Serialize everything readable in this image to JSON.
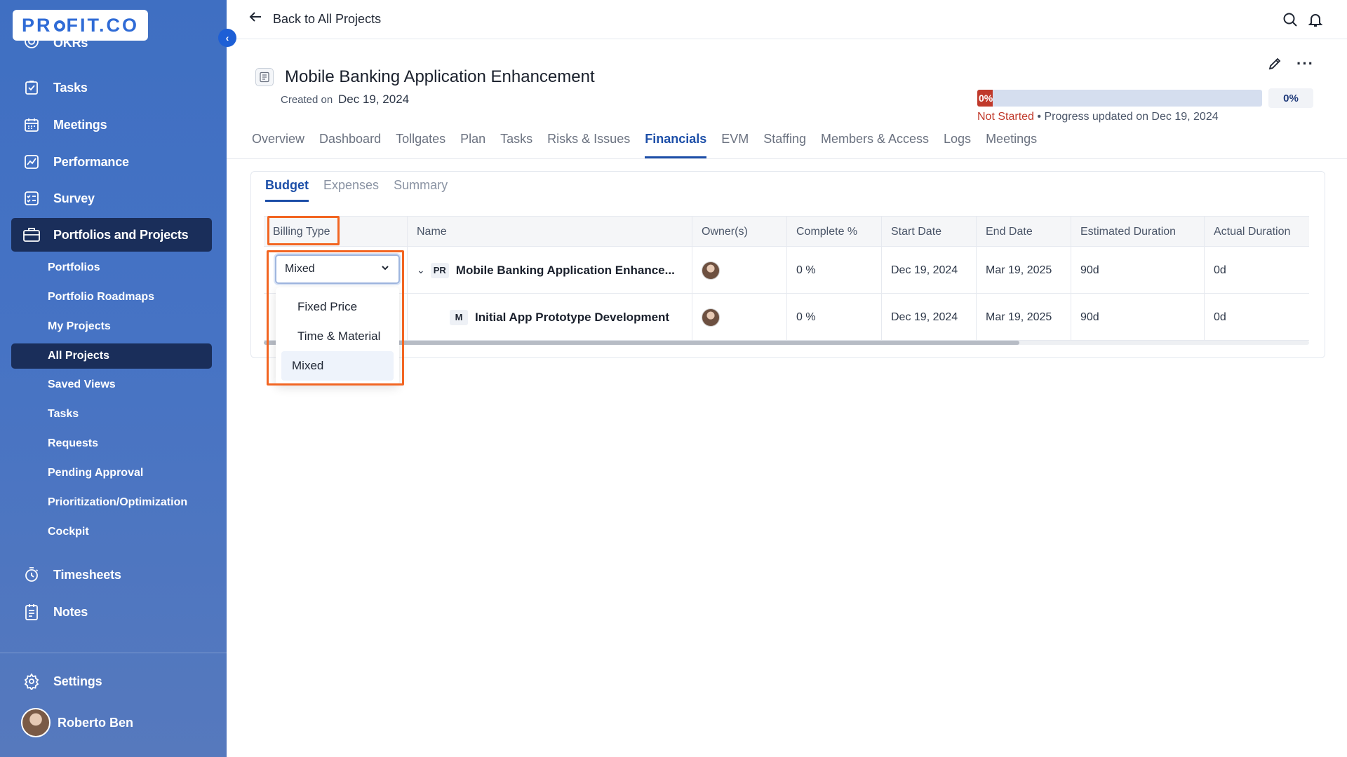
{
  "brand": {
    "logo_pre": "PR",
    "logo_post": "FIT.CO"
  },
  "sidebar": {
    "partial_item": "OKRs",
    "items": [
      {
        "label": "Tasks",
        "icon": "tasks-icon"
      },
      {
        "label": "Meetings",
        "icon": "calendar-icon"
      },
      {
        "label": "Performance",
        "icon": "performance-icon"
      },
      {
        "label": "Survey",
        "icon": "survey-icon"
      },
      {
        "label": "Portfolios and Projects",
        "icon": "briefcase-icon"
      }
    ],
    "sub_items": [
      "Portfolios",
      "Portfolio Roadmaps",
      "My Projects",
      "All Projects",
      "Saved Views",
      "Tasks",
      "Requests",
      "Pending Approval",
      "Prioritization/Optimization",
      "Cockpit"
    ],
    "after_items": [
      {
        "label": "Timesheets",
        "icon": "timer-icon"
      },
      {
        "label": "Notes",
        "icon": "notes-icon"
      }
    ],
    "settings": "Settings",
    "user_name": "Roberto Ben"
  },
  "topbar": {
    "back_label": "Back to All Projects"
  },
  "project": {
    "title": "Mobile Banking Application Enhancement",
    "created_label": "Created on",
    "created_date": "Dec 19, 2024",
    "progress_fill_label": "0%",
    "progress_pct": "0%",
    "status": "Not Started",
    "status_sep": " • ",
    "progress_updated": "Progress updated on Dec 19, 2024"
  },
  "tabs": [
    "Overview",
    "Dashboard",
    "Tollgates",
    "Plan",
    "Tasks",
    "Risks & Issues",
    "Financials",
    "EVM",
    "Staffing",
    "Members & Access",
    "Logs",
    "Meetings"
  ],
  "subtabs": [
    "Budget",
    "Expenses",
    "Summary"
  ],
  "table": {
    "headers": [
      "Billing Type",
      "Name",
      "Owner(s)",
      "Complete %",
      "Start Date",
      "End Date",
      "Estimated Duration",
      "Actual Duration"
    ],
    "rows": [
      {
        "type_badge": "PR",
        "name": "Mobile Banking Application Enhance...",
        "complete": "0 %",
        "start": "Dec 19, 2024",
        "end": "Mar 19, 2025",
        "est": "90d",
        "actual": "0d"
      },
      {
        "type_badge": "M",
        "name": "Initial App Prototype Development",
        "complete": "0 %",
        "start": "Dec 19, 2024",
        "end": "Mar 19, 2025",
        "est": "90d",
        "actual": "0d"
      }
    ]
  },
  "billing": {
    "selected": "Mixed",
    "options": [
      "Fixed Price",
      "Time & Material",
      "Mixed"
    ]
  },
  "colors": {
    "sidebar": "#4673c4",
    "active_nav": "#1a2e5a",
    "accent": "#1d4fa8",
    "highlight": "#f26522",
    "not_started": "#c0392b"
  }
}
